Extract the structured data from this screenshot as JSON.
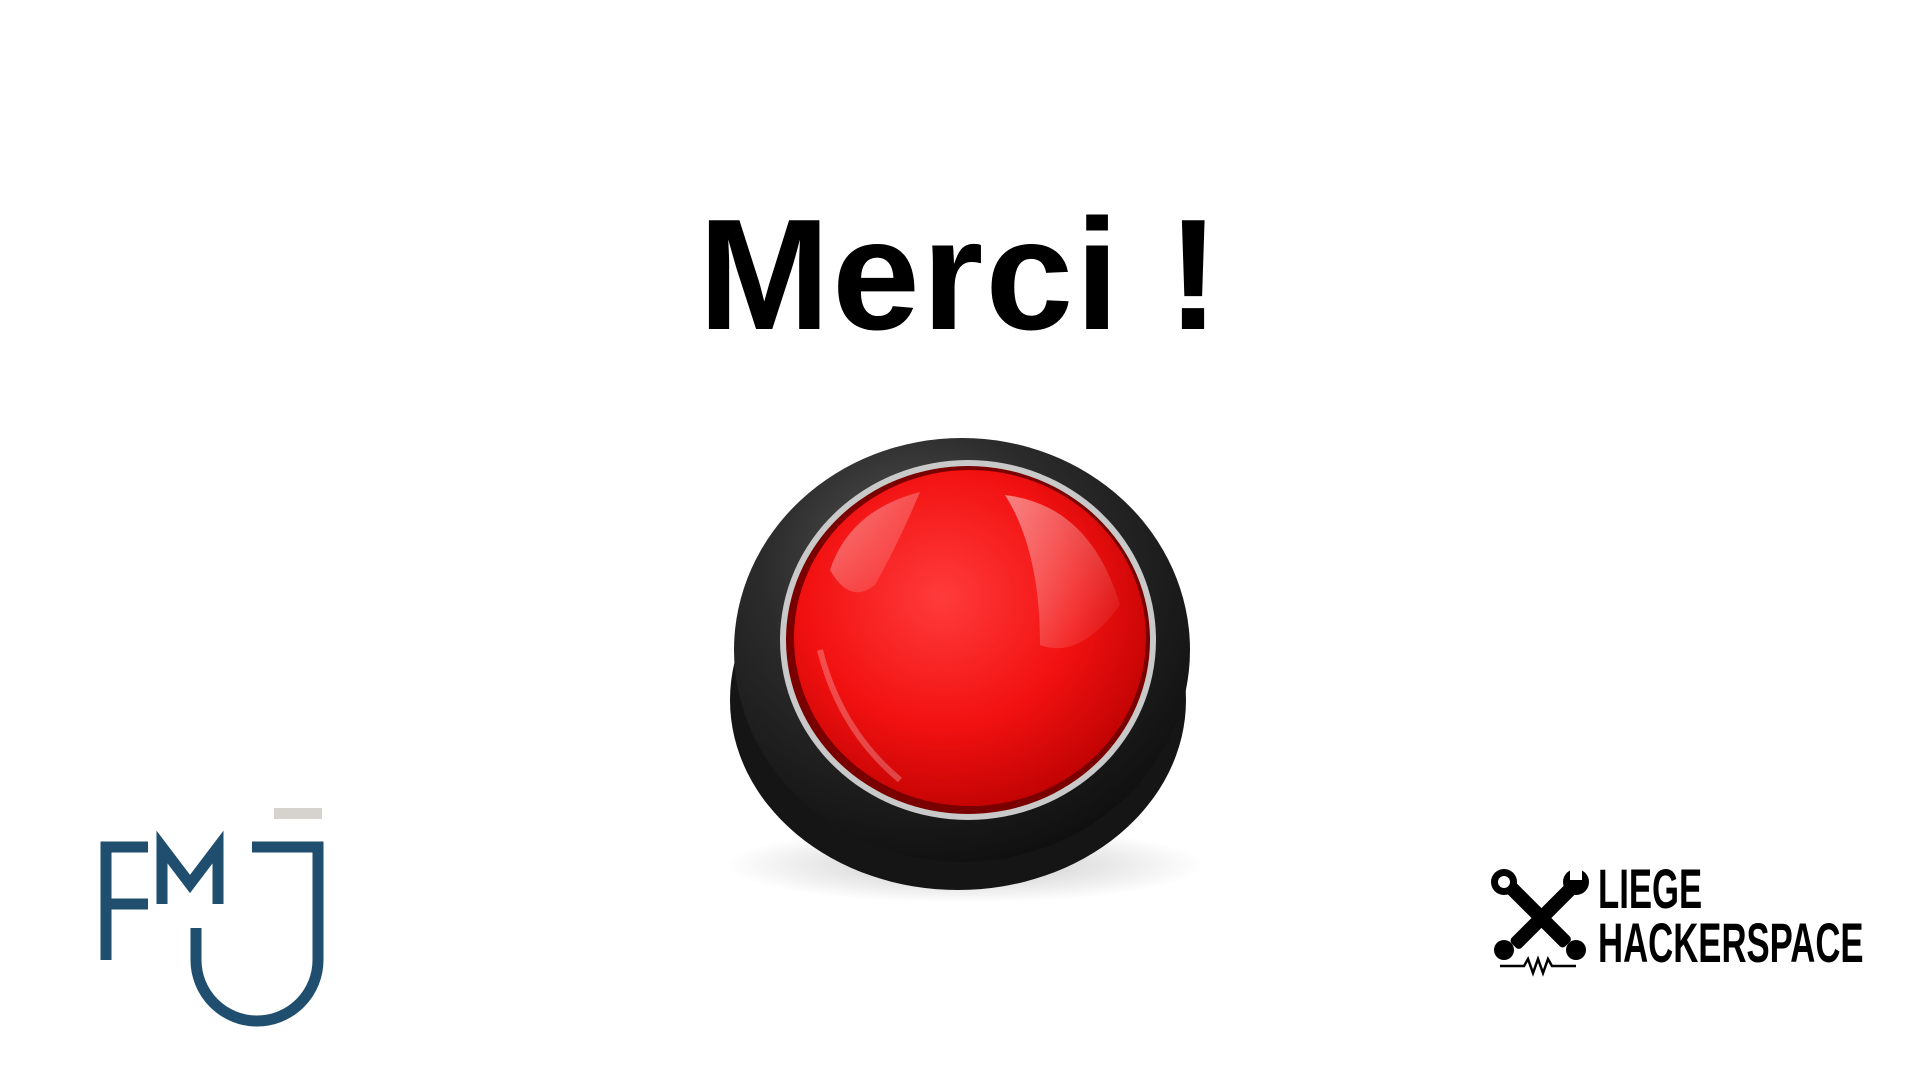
{
  "slide": {
    "title": "Merci !",
    "background": "#ffffff",
    "button_color": "#ff1a1a",
    "button_rim_color": "#1e1e1e"
  },
  "logos": {
    "fmj": {
      "icon": "fmj-logo-icon",
      "color": "#1f4e6e",
      "accent": "#d6d3ce"
    },
    "hackerspace": {
      "icon": "wrench-cross-icon",
      "line1": "LIEGE",
      "line2": "HACKERSPACE"
    }
  }
}
